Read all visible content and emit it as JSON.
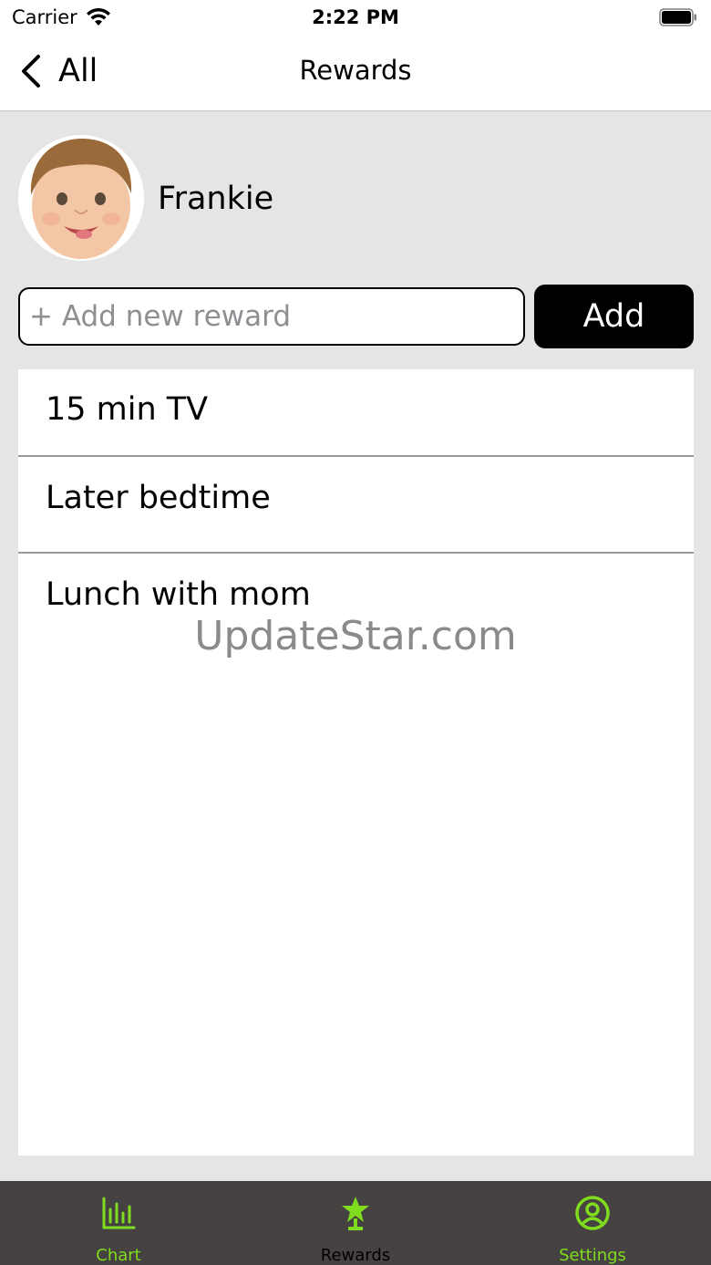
{
  "status_bar": {
    "carrier": "Carrier",
    "time": "2:22 PM"
  },
  "nav": {
    "back_label": "All",
    "title": "Rewards"
  },
  "profile": {
    "name": "Frankie"
  },
  "add_reward": {
    "placeholder": "+ Add new reward",
    "value": "",
    "button_label": "Add"
  },
  "rewards": [
    {
      "label": "15 min TV"
    },
    {
      "label": "Later bedtime"
    },
    {
      "label": "Lunch with mom"
    }
  ],
  "watermark": "UpdateStar.com",
  "tabs": [
    {
      "label": "Chart",
      "icon": "bar-chart-icon",
      "color": "#7fdc1e",
      "active": false
    },
    {
      "label": "Rewards",
      "icon": "star-trophy-icon",
      "color": "#000000",
      "icon_color": "#7fdc1e",
      "active": true
    },
    {
      "label": "Settings",
      "icon": "user-circle-icon",
      "color": "#7fdc1e",
      "active": false
    }
  ],
  "colors": {
    "accent_green": "#7fdc1e",
    "tab_bar_bg": "#454241",
    "page_bg": "#e6e5e6",
    "button_bg": "#000000"
  }
}
